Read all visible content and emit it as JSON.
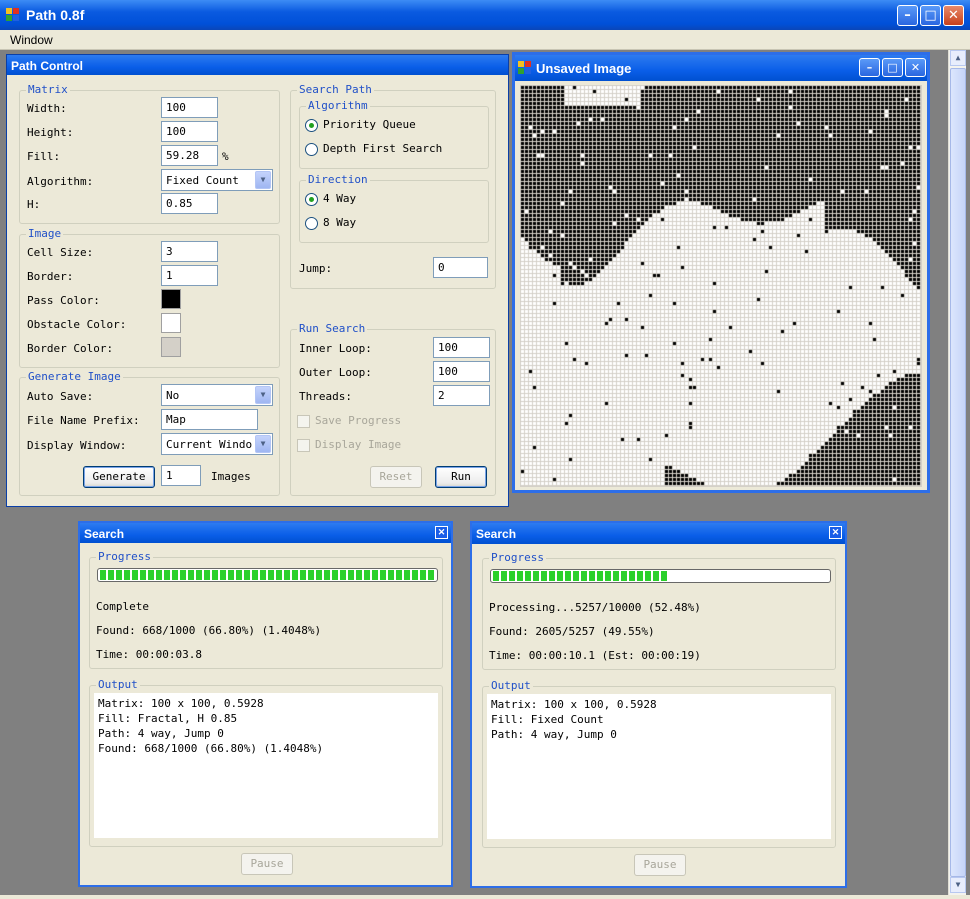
{
  "app": {
    "title": "Path 0.8f",
    "menu": [
      "Window"
    ]
  },
  "path_control": {
    "title": "Path Control",
    "matrix": {
      "legend": "Matrix",
      "width_label": "Width:",
      "width": "100",
      "height_label": "Height:",
      "height": "100",
      "fill_label": "Fill:",
      "fill": "59.28",
      "fill_unit": "%",
      "algorithm_label": "Algorithm:",
      "algorithm": "Fixed Count",
      "h_label": "H:",
      "h": "0.85"
    },
    "image": {
      "legend": "Image",
      "cell_size_label": "Cell Size:",
      "cell_size": "3",
      "border_label": "Border:",
      "border": "1",
      "pass_color_label": "Pass Color:",
      "obstacle_color_label": "Obstacle Color:",
      "border_color_label": "Border Color:",
      "pass_color": "#000000",
      "obstacle_color": "#ffffff",
      "border_color": "#d4d0c8"
    },
    "generate": {
      "legend": "Generate Image",
      "auto_save_label": "Auto Save:",
      "auto_save": "No",
      "prefix_label": "File Name Prefix:",
      "prefix": "Map",
      "display_label": "Display Window:",
      "display": "Current Windo",
      "button": "Generate",
      "count": "1",
      "count_unit": "Images"
    },
    "search_path": {
      "legend": "Search Path",
      "algorithm_legend": "Algorithm",
      "priority_queue": "Priority Queue",
      "depth_first": "Depth First Search",
      "direction_legend": "Direction",
      "four_way": "4 Way",
      "eight_way": "8 Way",
      "jump_label": "Jump:",
      "jump": "0"
    },
    "run_search": {
      "legend": "Run Search",
      "inner_label": "Inner Loop:",
      "inner": "100",
      "outer_label": "Outer Loop:",
      "outer": "100",
      "threads_label": "Threads:",
      "threads": "2",
      "save_progress": "Save Progress",
      "display_image": "Display Image",
      "reset": "Reset",
      "run": "Run"
    }
  },
  "image_window": {
    "title": "Unsaved Image"
  },
  "search1": {
    "title": "Search",
    "progress_legend": "Progress",
    "progress": 1.0,
    "status": "Complete",
    "found": "Found: 668/1000 (66.80%) (1.4048%)",
    "time": "Time: 00:00:03.8",
    "output_legend": "Output",
    "output": "Matrix: 100 x 100, 0.5928\nFill: Fractal, H 0.85\nPath: 4 way, Jump 0\nFound: 668/1000 (66.80%) (1.4048%)",
    "pause": "Pause"
  },
  "search2": {
    "title": "Search",
    "progress_legend": "Progress",
    "progress": 0.5248,
    "status": "Processing...5257/10000 (52.48%)",
    "found": "Found: 2605/5257 (49.55%)",
    "time": "Time: 00:00:10.1 (Est: 00:00:19)",
    "output_legend": "Output",
    "output": "Matrix: 100 x 100, 0.5928\nFill: Fixed Count\nPath: 4 way, Jump 0",
    "pause": "Pause"
  },
  "colors": {
    "titlebar": "#0a5ee8",
    "face": "#ece9d8",
    "legend": "#2050c8",
    "progress": "#2bd02b"
  }
}
